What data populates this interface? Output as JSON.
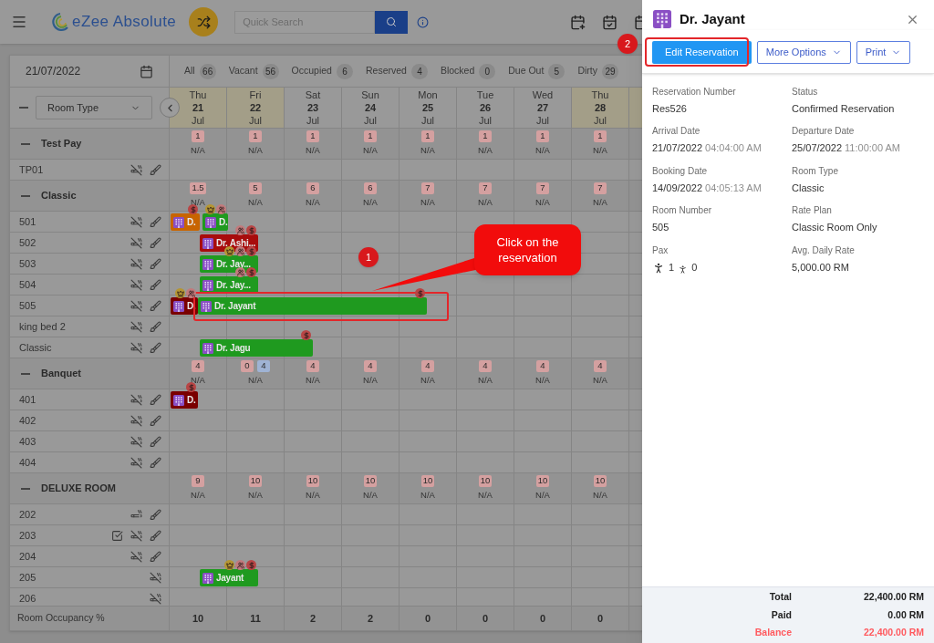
{
  "header": {
    "brand": "eZee Absolute",
    "search": {
      "placeholder": "Quick Search"
    }
  },
  "filter": {
    "date": "21/07/2022",
    "chips": [
      {
        "label": "All",
        "count": "66"
      },
      {
        "label": "Vacant",
        "count": "56"
      },
      {
        "label": "Occupied",
        "count": "6"
      },
      {
        "label": "Reserved",
        "count": "4"
      },
      {
        "label": "Blocked",
        "count": "0"
      },
      {
        "label": "Due Out",
        "count": "5"
      },
      {
        "label": "Dirty",
        "count": "29"
      }
    ]
  },
  "room_type_select": {
    "value": "Room Type"
  },
  "days": [
    {
      "weekday": "Thu",
      "date": "21",
      "month": "Jul",
      "highlighted": true
    },
    {
      "weekday": "Fri",
      "date": "22",
      "month": "Jul",
      "highlighted": true
    },
    {
      "weekday": "Sat",
      "date": "23",
      "month": "Jul",
      "highlighted": false
    },
    {
      "weekday": "Sun",
      "date": "24",
      "month": "Jul",
      "highlighted": false
    },
    {
      "weekday": "Mon",
      "date": "25",
      "month": "Jul",
      "highlighted": false
    },
    {
      "weekday": "Tue",
      "date": "26",
      "month": "Jul",
      "highlighted": false
    },
    {
      "weekday": "Wed",
      "date": "27",
      "month": "Jul",
      "highlighted": false
    },
    {
      "weekday": "Thu",
      "date": "28",
      "month": "Jul",
      "highlighted": true
    }
  ],
  "groups": [
    {
      "name": "Test Pay",
      "expanded": true,
      "availability": [
        {
          "counts": [
            {
              "value": "1",
              "color": "#d4a0a0"
            }
          ],
          "rate": "N/A"
        },
        {
          "counts": [
            {
              "value": "1",
              "color": "#d4a0a0"
            }
          ],
          "rate": "N/A"
        },
        {
          "counts": [
            {
              "value": "1",
              "color": "#d4a0a0"
            }
          ],
          "rate": "N/A"
        },
        {
          "counts": [
            {
              "value": "1",
              "color": "#d4a0a0"
            }
          ],
          "rate": "N/A"
        },
        {
          "counts": [
            {
              "value": "1",
              "color": "#d4a0a0"
            }
          ],
          "rate": "N/A"
        },
        {
          "counts": [
            {
              "value": "1",
              "color": "#d4a0a0"
            }
          ],
          "rate": "N/A"
        },
        {
          "counts": [
            {
              "value": "1",
              "color": "#d4a0a0"
            }
          ],
          "rate": "N/A"
        },
        {
          "counts": [
            {
              "value": "1",
              "color": "#d4a0a0"
            }
          ],
          "rate": "N/A"
        }
      ],
      "rooms": [
        {
          "name": "TP01",
          "icons": [
            {
              "kind": "no-smoking"
            },
            {
              "kind": "housekeeping"
            }
          ]
        }
      ]
    },
    {
      "name": "Classic",
      "expanded": true,
      "availability": [
        {
          "counts": [
            {
              "value": "1.5",
              "color": "#d4a0a0"
            }
          ],
          "rate": "N/A"
        },
        {
          "counts": [
            {
              "value": "5",
              "color": "#d4a0a0"
            }
          ],
          "rate": "N/A"
        },
        {
          "counts": [
            {
              "value": "6",
              "color": "#d4a0a0"
            }
          ],
          "rate": "N/A"
        },
        {
          "counts": [
            {
              "value": "6",
              "color": "#d4a0a0"
            }
          ],
          "rate": "N/A"
        },
        {
          "counts": [
            {
              "value": "7",
              "color": "#d4a0a0"
            }
          ],
          "rate": "N/A"
        },
        {
          "counts": [
            {
              "value": "7",
              "color": "#d4a0a0"
            }
          ],
          "rate": "N/A"
        },
        {
          "counts": [
            {
              "value": "7",
              "color": "#d4a0a0"
            }
          ],
          "rate": "N/A"
        },
        {
          "counts": [
            {
              "value": "7",
              "color": "#d4a0a0"
            }
          ],
          "rate": "N/A"
        }
      ],
      "rooms": [
        {
          "name": "501",
          "icons": [
            {
              "kind": "no-smoking"
            },
            {
              "kind": "housekeeping"
            }
          ],
          "bookings": [
            {
              "guest": "D.",
              "color": "#c86400",
              "icons": [
                {
                  "kind": "payment"
                }
              ]
            },
            {
              "guest": "D.",
              "color": "#1f9a1f",
              "icons": [
                {
                  "kind": "crown"
                },
                {
                  "kind": "guests"
                }
              ]
            }
          ]
        },
        {
          "name": "502",
          "icons": [
            {
              "kind": "no-smoking"
            },
            {
              "kind": "housekeeping"
            }
          ],
          "bookings": [
            {
              "guest": "Dr. Ashi...",
              "color": "#a80c0c",
              "icons": [
                {
                  "kind": "guests"
                },
                {
                  "kind": "payment"
                }
              ]
            }
          ]
        },
        {
          "name": "503",
          "icons": [
            {
              "kind": "no-smoking"
            },
            {
              "kind": "housekeeping"
            }
          ],
          "bookings": [
            {
              "guest": "Dr. Jay...",
              "color": "#1f9a1f",
              "icons": [
                {
                  "kind": "crown"
                },
                {
                  "kind": "guests"
                },
                {
                  "kind": "payment"
                }
              ]
            }
          ]
        },
        {
          "name": "504",
          "icons": [
            {
              "kind": "no-smoking"
            },
            {
              "kind": "housekeeping"
            }
          ],
          "bookings": [
            {
              "guest": "Dr. Jay...",
              "color": "#1f9a1f",
              "icons": [
                {
                  "kind": "guests"
                },
                {
                  "kind": "payment"
                }
              ]
            }
          ]
        },
        {
          "name": "505",
          "icons": [
            {
              "kind": "no-smoking"
            },
            {
              "kind": "housekeeping"
            }
          ],
          "bookings": [
            {
              "guest": "D.",
              "color": "#7a0000",
              "icons": [
                {
                  "kind": "crown"
                },
                {
                  "kind": "guests"
                }
              ]
            },
            {
              "guest": "Dr. Jayant",
              "color": "#1f9a1f",
              "icons": [
                {
                  "kind": "payment"
                }
              ]
            }
          ]
        },
        {
          "name": "king bed 2",
          "icons": [
            {
              "kind": "no-smoking"
            },
            {
              "kind": "housekeeping"
            }
          ]
        },
        {
          "name": "Classic",
          "icons": [
            {
              "kind": "no-smoking"
            },
            {
              "kind": "housekeeping"
            }
          ],
          "bookings": [
            {
              "guest": "Dr. Jagu",
              "color": "#1f9a1f",
              "icons": [
                {
                  "kind": "payment"
                }
              ]
            }
          ]
        }
      ]
    },
    {
      "name": "Banquet",
      "expanded": true,
      "availability": [
        {
          "counts": [
            {
              "value": "4",
              "color": "#d4a0a0"
            }
          ],
          "rate": "N/A"
        },
        {
          "counts": [
            {
              "value": "0",
              "color": "#d4a0a0"
            },
            {
              "value": "4",
              "color": "#9fb3d4"
            }
          ],
          "rate": "N/A"
        },
        {
          "counts": [
            {
              "value": "4",
              "color": "#d4a0a0"
            }
          ],
          "rate": "N/A"
        },
        {
          "counts": [
            {
              "value": "4",
              "color": "#d4a0a0"
            }
          ],
          "rate": "N/A"
        },
        {
          "counts": [
            {
              "value": "4",
              "color": "#d4a0a0"
            }
          ],
          "rate": "N/A"
        },
        {
          "counts": [
            {
              "value": "4",
              "color": "#d4a0a0"
            }
          ],
          "rate": "N/A"
        },
        {
          "counts": [
            {
              "value": "4",
              "color": "#d4a0a0"
            }
          ],
          "rate": "N/A"
        },
        {
          "counts": [
            {
              "value": "4",
              "color": "#d4a0a0"
            }
          ],
          "rate": "N/A"
        }
      ],
      "rooms": [
        {
          "name": "401",
          "icons": [
            {
              "kind": "no-smoking"
            },
            {
              "kind": "housekeeping"
            }
          ],
          "bookings": [
            {
              "guest": "D.",
              "color": "#7a0000",
              "icons": [
                {
                  "kind": "payment"
                }
              ]
            }
          ]
        },
        {
          "name": "402",
          "icons": [
            {
              "kind": "no-smoking"
            },
            {
              "kind": "housekeeping"
            }
          ]
        },
        {
          "name": "403",
          "icons": [
            {
              "kind": "no-smoking"
            },
            {
              "kind": "housekeeping"
            }
          ]
        },
        {
          "name": "404",
          "icons": [
            {
              "kind": "no-smoking"
            },
            {
              "kind": "housekeeping"
            }
          ]
        }
      ]
    },
    {
      "name": "DELUXE ROOM",
      "expanded": true,
      "availability": [
        {
          "counts": [
            {
              "value": "9",
              "color": "#d4a0a0"
            }
          ],
          "rate": "N/A"
        },
        {
          "counts": [
            {
              "value": "10",
              "color": "#d4a0a0"
            }
          ],
          "rate": "N/A"
        },
        {
          "counts": [
            {
              "value": "10",
              "color": "#d4a0a0"
            }
          ],
          "rate": "N/A"
        },
        {
          "counts": [
            {
              "value": "10",
              "color": "#d4a0a0"
            }
          ],
          "rate": "N/A"
        },
        {
          "counts": [
            {
              "value": "10",
              "color": "#d4a0a0"
            }
          ],
          "rate": "N/A"
        },
        {
          "counts": [
            {
              "value": "10",
              "color": "#d4a0a0"
            }
          ],
          "rate": "N/A"
        },
        {
          "counts": [
            {
              "value": "10",
              "color": "#d4a0a0"
            }
          ],
          "rate": "N/A"
        },
        {
          "counts": [
            {
              "value": "10",
              "color": "#d4a0a0"
            }
          ],
          "rate": "N/A"
        }
      ],
      "rooms": [
        {
          "name": "202",
          "icons": [
            {
              "kind": "smoking"
            },
            {
              "kind": "housekeeping"
            }
          ]
        },
        {
          "name": "203",
          "icons": [
            {
              "kind": "checklist"
            },
            {
              "kind": "no-smoking"
            },
            {
              "kind": "housekeeping"
            }
          ]
        },
        {
          "name": "204",
          "icons": [
            {
              "kind": "no-smoking"
            },
            {
              "kind": "housekeeping"
            }
          ]
        },
        {
          "name": "205",
          "icons": [
            {
              "kind": "no-smoking"
            }
          ],
          "bookings": [
            {
              "guest": "Jayant",
              "color": "#1f9a1f",
              "icons": [
                {
                  "kind": "crown"
                },
                {
                  "kind": "guests"
                },
                {
                  "kind": "payment"
                }
              ]
            }
          ]
        },
        {
          "name": "206",
          "icons": [
            {
              "kind": "no-smoking"
            }
          ]
        }
      ]
    }
  ],
  "occupancy": {
    "label": "Room Occupancy %",
    "values": [
      "10",
      "11",
      "2",
      "2",
      "0",
      "0",
      "0",
      "0"
    ]
  },
  "panel": {
    "title": "Dr. Jayant",
    "buttons": [
      {
        "label": "Edit Reservation",
        "kind": "primary"
      },
      {
        "label": "More Options",
        "kind": "dropdown"
      },
      {
        "label": "Print",
        "kind": "dropdown"
      }
    ],
    "details": [
      {
        "kind": "text",
        "label": "Reservation Number",
        "value": "Res526"
      },
      {
        "kind": "text",
        "label": "Status",
        "value": "Confirmed Reservation"
      },
      {
        "kind": "datetime",
        "label": "Arrival Date",
        "value": "21/07/2022",
        "time": "04:04:00 AM"
      },
      {
        "kind": "datetime",
        "label": "Departure Date",
        "value": "25/07/2022",
        "time": "11:00:00 AM"
      },
      {
        "kind": "datetime",
        "label": "Booking Date",
        "value": "14/09/2022",
        "time": "04:05:13 AM"
      },
      {
        "kind": "text",
        "label": "Room Type",
        "value": "Classic"
      },
      {
        "kind": "text",
        "label": "Room Number",
        "value": "505"
      },
      {
        "kind": "text",
        "label": "Rate Plan",
        "value": "Classic Room Only"
      },
      {
        "kind": "pax",
        "label": "Pax",
        "adults": "1",
        "children": "0"
      },
      {
        "kind": "text",
        "label": "Avg. Daily Rate",
        "value": "5,000.00 RM"
      }
    ],
    "totals": [
      {
        "label": "Total",
        "value": "22,400.00 RM",
        "kind": "normal"
      },
      {
        "label": "Paid",
        "value": "0.00 RM",
        "kind": "normal"
      },
      {
        "label": "Balance",
        "value": "22,400.00 RM",
        "kind": "due"
      }
    ]
  },
  "annotations": [
    {
      "kind": "step",
      "label": "1"
    },
    {
      "kind": "callout",
      "text": "Click on the reservation"
    },
    {
      "kind": "step",
      "label": "2"
    }
  ]
}
